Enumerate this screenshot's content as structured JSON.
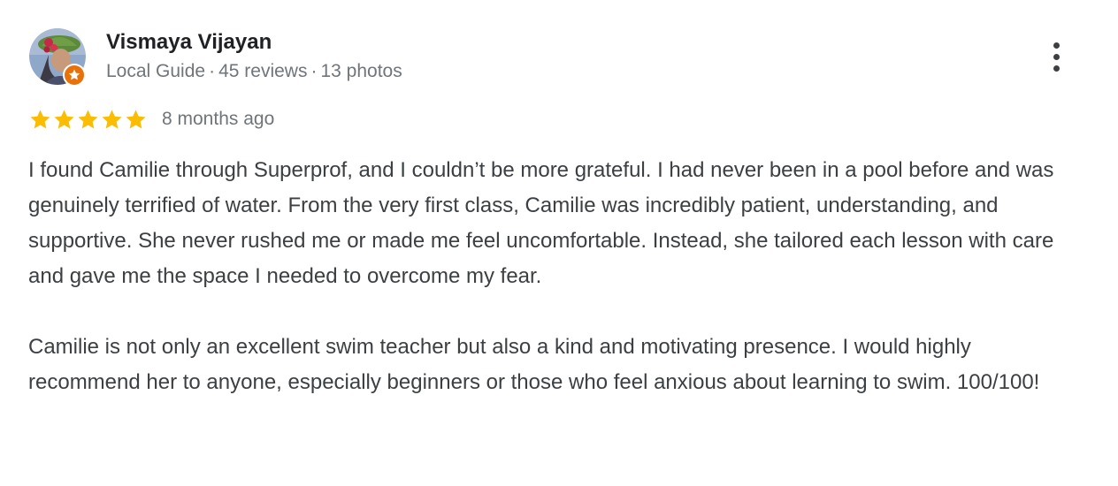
{
  "reviewer": {
    "name": "Vismaya Vijayan",
    "level": "Local Guide",
    "reviews": "45 reviews",
    "photos": "13 photos",
    "separator": "·",
    "avatar_icon": "profile-photo-avatar",
    "badge_icon": "local-guide-star-badge",
    "badge_color": "#e8710a"
  },
  "rating": {
    "stars": 5,
    "max": 5,
    "star_color": "#fbbc04",
    "time": "8 months ago"
  },
  "review": {
    "paragraphs": [
      "I found Camilie through Superprof, and I couldn’t be more grateful. I had never been in a pool before and was genuinely terrified of water. From the very first class, Camilie was incredibly patient, understanding, and supportive. She never rushed me or made me feel uncomfortable. Instead, she tailored each lesson with care and gave me the space I needed to overcome my fear.",
      "Camilie is not only an excellent swim teacher but also a kind and motivating presence. I would highly recommend her to anyone, especially beginners or those who feel anxious about learning to swim. 100/100!"
    ]
  },
  "menu": {
    "icon": "more-vert-icon"
  }
}
